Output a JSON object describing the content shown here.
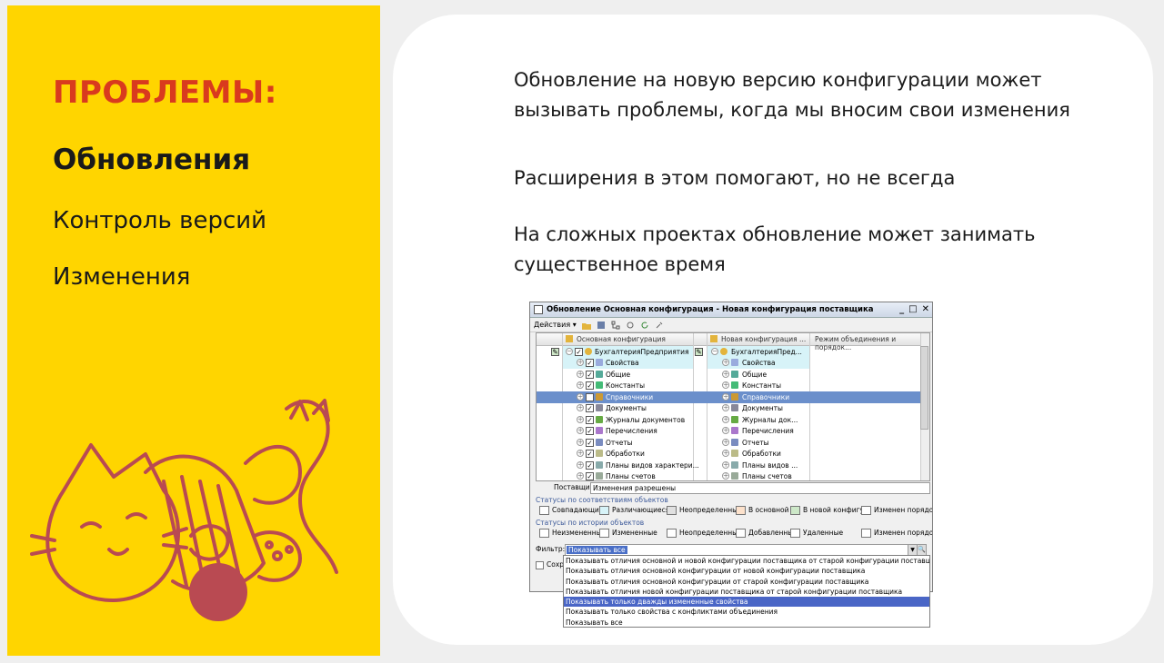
{
  "sidebar": {
    "heading": "ПРОБЛЕМЫ:",
    "items": [
      {
        "label": "Обновления",
        "active": true
      },
      {
        "label": "Контроль версий",
        "active": false
      },
      {
        "label": "Изменения",
        "active": false
      }
    ]
  },
  "content": {
    "paragraph1_line1": "Обновление на новую версию конфигурации может",
    "paragraph1_line2": "вызывать проблемы, когда мы вносим свои изменения",
    "paragraph2": "Расширения в этом помогают, но не всегда",
    "paragraph3_line1": "На сложных проектах обновление может занимать",
    "paragraph3_line2": "существенное время"
  },
  "window": {
    "title": "Обновление Основная конфигурация - Новая конфигурация поставщика",
    "controls": [
      "_",
      "□",
      "✕"
    ],
    "toolbar_actions": "Действия ▾",
    "columns": [
      "Основная конфигурация",
      "Новая конфигурация ...",
      "Режим объединения и порядок..."
    ],
    "tree_left": [
      "БухгалтерияПредприятия",
      "Свойства",
      "Общие",
      "Константы",
      "Справочники",
      "Документы",
      "Журналы документов",
      "Перечисления",
      "Отчеты",
      "Обработки",
      "Планы видов характери...",
      "Планы счетов"
    ],
    "tree_right": [
      "БухгалтерияПред...",
      "Свойства",
      "Общие",
      "Константы",
      "Справочники",
      "Документы",
      "Журналы док...",
      "Перечисления",
      "Отчеты",
      "Обработки",
      "Планы видов ...",
      "Планы счетов"
    ],
    "selected_index": 4,
    "supplier_label": "Поставщик:",
    "supplier_value": "Изменения разрешены",
    "status_group1": "Статусы по соответствиям объектов",
    "status_items1": [
      "Совпадающие",
      "Различающиеся",
      "Неопределенные",
      "В основной",
      "В новой конфигу...",
      "Изменен порядок"
    ],
    "status_group2": "Статусы по истории объектов",
    "status_items2": [
      "Неизмененные",
      "Измененные",
      "Неопределенные",
      "Добавленные",
      "Удаленные",
      "Изменен порядок"
    ],
    "filter_label": "Фильтр:",
    "filter_value": "Показывать все",
    "save_checkbox_label": "Сохра",
    "status_colors1": [
      "#ffffff",
      "#d7f3f8",
      "#e0e0e0",
      "#fde2cc",
      "#cde8c8",
      "#ffffff"
    ]
  },
  "dropdown_options": [
    "Показывать отличия основной и новой конфигурации поставщика от старой конфигурации поставщика",
    "Показывать отличия основной конфигурации от новой конфигурации поставщика",
    "Показывать отличия основной конфигурации от старой конфигурации поставщика",
    "Показывать отличия новой конфигурации поставщика от старой конфигурации поставщика",
    "Показывать только дважды измененные свойства",
    "Показывать только свойства с конфликтами объединения",
    "Показывать все"
  ],
  "dropdown_highlight_index": 4,
  "colors": {
    "accent_yellow": "#ffd500",
    "heading_red": "#d93a1e",
    "cat_red": "#b94a52",
    "selection_blue": "#6b8fcb"
  }
}
